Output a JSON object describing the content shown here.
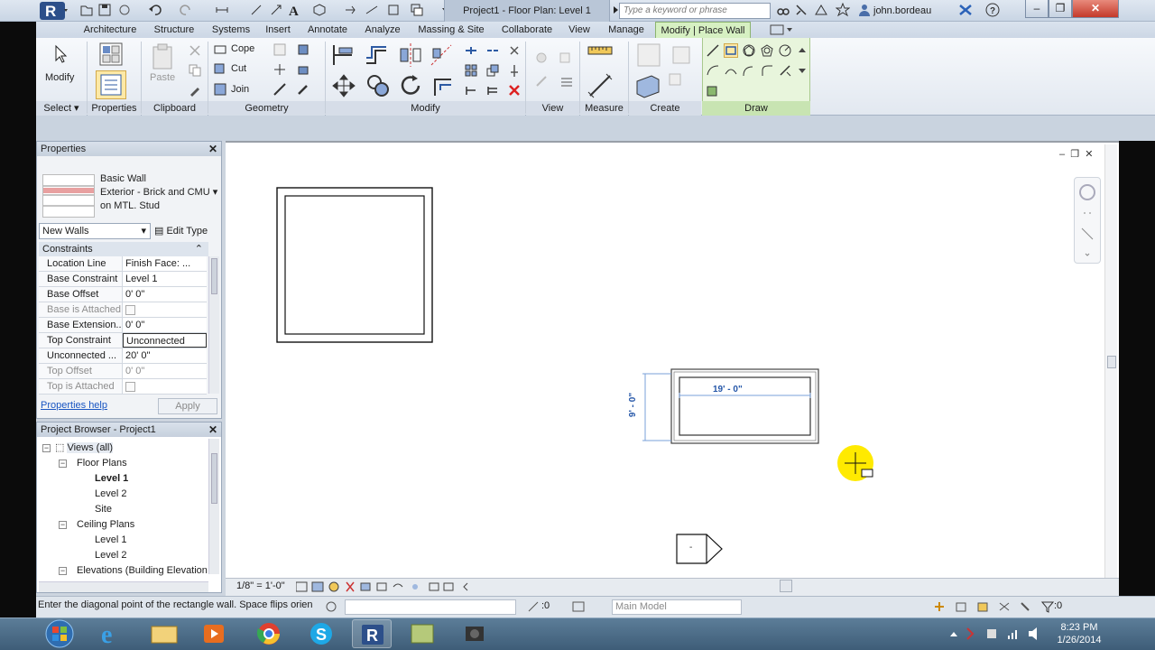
{
  "titlebar": {
    "doc_title": "Project1 - Floor Plan: Level 1",
    "search_placeholder": "Type a keyword or phrase",
    "user": "john.bordeau"
  },
  "tabs": [
    "Architecture",
    "Structure",
    "Systems",
    "Insert",
    "Annotate",
    "Analyze",
    "Massing & Site",
    "Collaborate",
    "View",
    "Manage",
    "Modify | Place Wall"
  ],
  "ribbon": {
    "modify_label": "Modify",
    "paste_label": "Paste",
    "cope_label": "Cope",
    "cut_label": "Cut",
    "join_label": "Join",
    "panels": [
      "Select",
      "Properties",
      "Clipboard",
      "Geometry",
      "Modify",
      "View",
      "Measure",
      "Create",
      "Draw"
    ]
  },
  "properties": {
    "title": "Properties",
    "type_line1": "Basic Wall",
    "type_line2": "Exterior - Brick and CMU",
    "type_line3": "on MTL. Stud",
    "instance_filter": "New Walls",
    "edit_type": "Edit Type",
    "section": "Constraints",
    "rows": [
      {
        "key": "Location Line",
        "value": "Finish Face: ..."
      },
      {
        "key": "Base Constraint",
        "value": "Level 1"
      },
      {
        "key": "Base Offset",
        "value": "0'  0\""
      },
      {
        "key": "Base is Attached",
        "value": ""
      },
      {
        "key": "Base Extension...",
        "value": "0'  0\""
      },
      {
        "key": "Top Constraint",
        "value": "Unconnected"
      },
      {
        "key": "Unconnected ...",
        "value": "20'  0\""
      },
      {
        "key": "Top Offset",
        "value": "0'  0\""
      },
      {
        "key": "Top is Attached",
        "value": ""
      }
    ],
    "help": "Properties help",
    "apply": "Apply"
  },
  "browser": {
    "title": "Project Browser - Project1",
    "views": "Views (all)",
    "floor_plans": "Floor Plans",
    "fp_items": [
      "Level 1",
      "Level 2",
      "Site"
    ],
    "ceiling_plans": "Ceiling Plans",
    "cp_items": [
      "Level 1",
      "Level 2"
    ],
    "elevations": "Elevations (Building Elevation"
  },
  "canvas": {
    "dim_width": "19' - 0\"",
    "dim_height": "9' - 0\"",
    "elev_tag": "-"
  },
  "viewbar": {
    "scale": "1/8\" = 1'-0\""
  },
  "statusbar": {
    "prompt": "Enter the diagonal point of the rectangle wall.  Space flips orien",
    "counter": ":0",
    "model": "Main Model",
    "filter_count": ":0"
  },
  "clock": {
    "time": "8:23 PM",
    "date": "1/26/2014"
  }
}
